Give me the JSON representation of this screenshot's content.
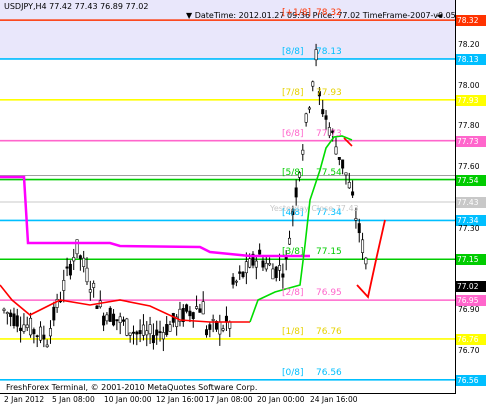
{
  "header": {
    "symbol_info": "USDJPY,H4  77.42 77.43 76.89 77.02",
    "info": "DateTime: 2012.01.27 09:36   Price: 77.02   TimeFrame-2007-v0.05"
  },
  "murrey_levels": [
    {
      "tag": "[+1/8]",
      "price": "78.32",
      "value": 78.32,
      "color": "#ff3300",
      "tag_color": "#ff3300"
    },
    {
      "tag": "[8/8]",
      "price": "78.13",
      "value": 78.13,
      "color": "#00bfff",
      "tag_color": "#00bfff"
    },
    {
      "tag": "[7/8]",
      "price": "77.93",
      "value": 77.93,
      "color": "#ffff00",
      "tag_color": "#e6d200"
    },
    {
      "tag": "[6/8]",
      "price": "77.73",
      "value": 77.73,
      "color": "#ff66cc",
      "tag_color": "#ff66cc"
    },
    {
      "tag": "[5/8]",
      "price": "77.54",
      "value": 77.54,
      "color": "#00cc00",
      "tag_color": "#00cc00"
    },
    {
      "tag": "[4/8]",
      "price": "77.34",
      "value": 77.34,
      "color": "#00bfff",
      "tag_color": "#00bfff"
    },
    {
      "tag": "[3/8]",
      "price": "77.15",
      "value": 77.15,
      "color": "#00cc00",
      "tag_color": "#00cc00"
    },
    {
      "tag": "[2/8]",
      "price": "76.95",
      "value": 76.95,
      "color": "#ff66cc",
      "tag_color": "#ff66cc"
    },
    {
      "tag": "[1/8]",
      "price": "76.76",
      "value": 76.76,
      "color": "#ffff00",
      "tag_color": "#e6d200"
    },
    {
      "tag": "[0/8]",
      "price": "76.56",
      "value": 76.56,
      "color": "#00bfff",
      "tag_color": "#00bfff"
    }
  ],
  "yesterday_close": {
    "label": "Yesterday Close 77.43",
    "value": 77.43
  },
  "current_price": {
    "label": "77.02",
    "value": 77.02
  },
  "price_axis": {
    "ticks": [
      "78.32",
      "78.20",
      "78.13",
      "78.00",
      "77.93",
      "77.80",
      "77.73",
      "77.60",
      "77.54",
      "77.43",
      "77.34",
      "77.30",
      "77.15",
      "77.02",
      "76.95",
      "76.90",
      "76.76",
      "76.70",
      "76.56"
    ],
    "min": 76.52,
    "max": 78.35
  },
  "time_axis": [
    "2 Jan 2012",
    "5 Jan 08:00",
    "10 Jan 00:00",
    "12 Jan 16:00",
    "17 Jan 08:00",
    "20 Jan 00:00",
    "24 Jan 16:00"
  ],
  "copyright": "FreshForex Terminal, © 2001-2010 MetaQuotes Software Corp.",
  "colors": {
    "background": "#ffffff",
    "band": "#e9e7fb",
    "candles": "#000000",
    "ma_magenta": "#ff00ff",
    "ma_red": "#ff0000",
    "ma_green": "#00dd00"
  }
}
